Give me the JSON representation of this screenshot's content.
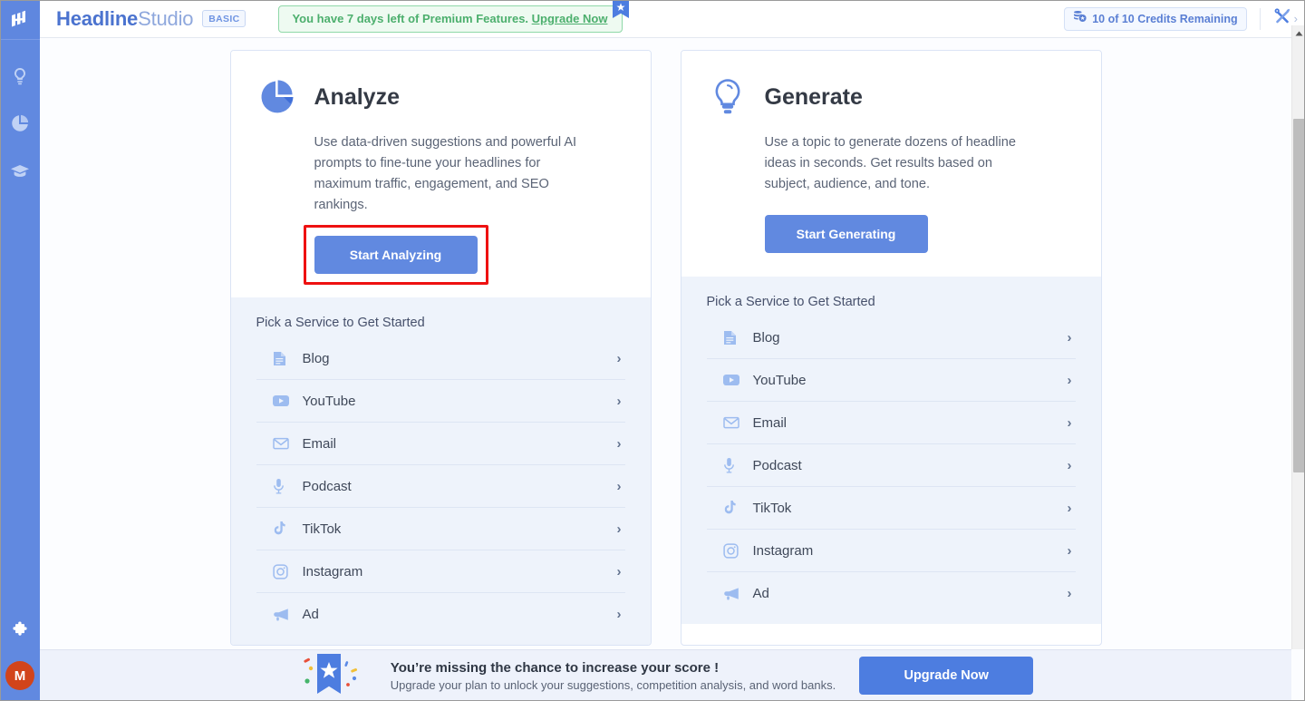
{
  "app": {
    "brand_bold": "Headline",
    "brand_light": "Studio",
    "plan_badge": "BASIC",
    "logo_icon": "headline-studio-logo"
  },
  "header": {
    "promo": {
      "text_before": "You have 7 days left of Premium Features. ",
      "link_text": "Upgrade Now",
      "flag_icon": "bookmark-star-icon",
      "border_color": "#8fd8a8",
      "text_color": "#4caf6d"
    },
    "credits": {
      "icon": "credits-coin-icon",
      "label": "10 of 10 Credits Remaining",
      "used": 10,
      "total": 10
    },
    "tools": {
      "icon": "tools-wrench-screwdriver-icon",
      "chevron": "›"
    }
  },
  "sidebar": {
    "items": [
      {
        "icon": "lightbulb-icon",
        "name": "sidebar-item-ideas"
      },
      {
        "icon": "pie-chart-icon",
        "name": "sidebar-item-analytics"
      },
      {
        "icon": "graduation-cap-icon",
        "name": "sidebar-item-learn"
      }
    ],
    "bottom": [
      {
        "icon": "puzzle-piece-icon",
        "name": "sidebar-item-extensions"
      }
    ],
    "avatar_initial": "M",
    "avatar_color": "#d2441b",
    "rail_color": "#6189e0"
  },
  "cards": [
    {
      "id": "analyze",
      "icon": "pie-chart-icon",
      "title": "Analyze",
      "description": "Use data-driven suggestions and powerful AI prompts to fine-tune your headlines for maximum traffic, engagement, and SEO rankings.",
      "button_label": "Start Analyzing",
      "highlighted": true,
      "highlight_color": "#ee1111",
      "section_title": "Pick a Service to Get Started",
      "services": [
        {
          "icon": "document-icon",
          "label": "Blog",
          "arrow": "›"
        },
        {
          "icon": "youtube-icon",
          "label": "YouTube",
          "arrow": "›"
        },
        {
          "icon": "email-icon",
          "label": "Email",
          "arrow": "›"
        },
        {
          "icon": "microphone-icon",
          "label": "Podcast",
          "arrow": "›"
        },
        {
          "icon": "tiktok-icon",
          "label": "TikTok",
          "arrow": "›"
        },
        {
          "icon": "instagram-icon",
          "label": "Instagram",
          "arrow": "›"
        },
        {
          "icon": "megaphone-icon",
          "label": "Ad",
          "arrow": "›"
        }
      ]
    },
    {
      "id": "generate",
      "icon": "lightbulb-icon",
      "title": "Generate",
      "description": "Use a topic to generate dozens of headline ideas in seconds. Get results based on subject, audience, and tone.",
      "button_label": "Start Generating",
      "highlighted": false,
      "section_title": "Pick a Service to Get Started",
      "services": [
        {
          "icon": "document-icon",
          "label": "Blog",
          "arrow": "›"
        },
        {
          "icon": "youtube-icon",
          "label": "YouTube",
          "arrow": "›"
        },
        {
          "icon": "email-icon",
          "label": "Email",
          "arrow": "›"
        },
        {
          "icon": "microphone-icon",
          "label": "Podcast",
          "arrow": "›"
        },
        {
          "icon": "tiktok-icon",
          "label": "TikTok",
          "arrow": "›"
        },
        {
          "icon": "instagram-icon",
          "label": "Instagram",
          "arrow": "›"
        },
        {
          "icon": "megaphone-icon",
          "label": "Ad",
          "arrow": "›"
        }
      ]
    }
  ],
  "banner": {
    "icon": "bookmark-star-confetti-icon",
    "headline": "You’re missing the chance to increase your score !",
    "subtext": "Upgrade your plan to unlock your suggestions, competition analysis, and word banks.",
    "button_label": "Upgrade Now",
    "button_color": "#4d7de0"
  },
  "theme": {
    "accent": "#6189e0",
    "page_bg": "#fcfdff",
    "card_bottom_bg": "#eef3fb"
  }
}
